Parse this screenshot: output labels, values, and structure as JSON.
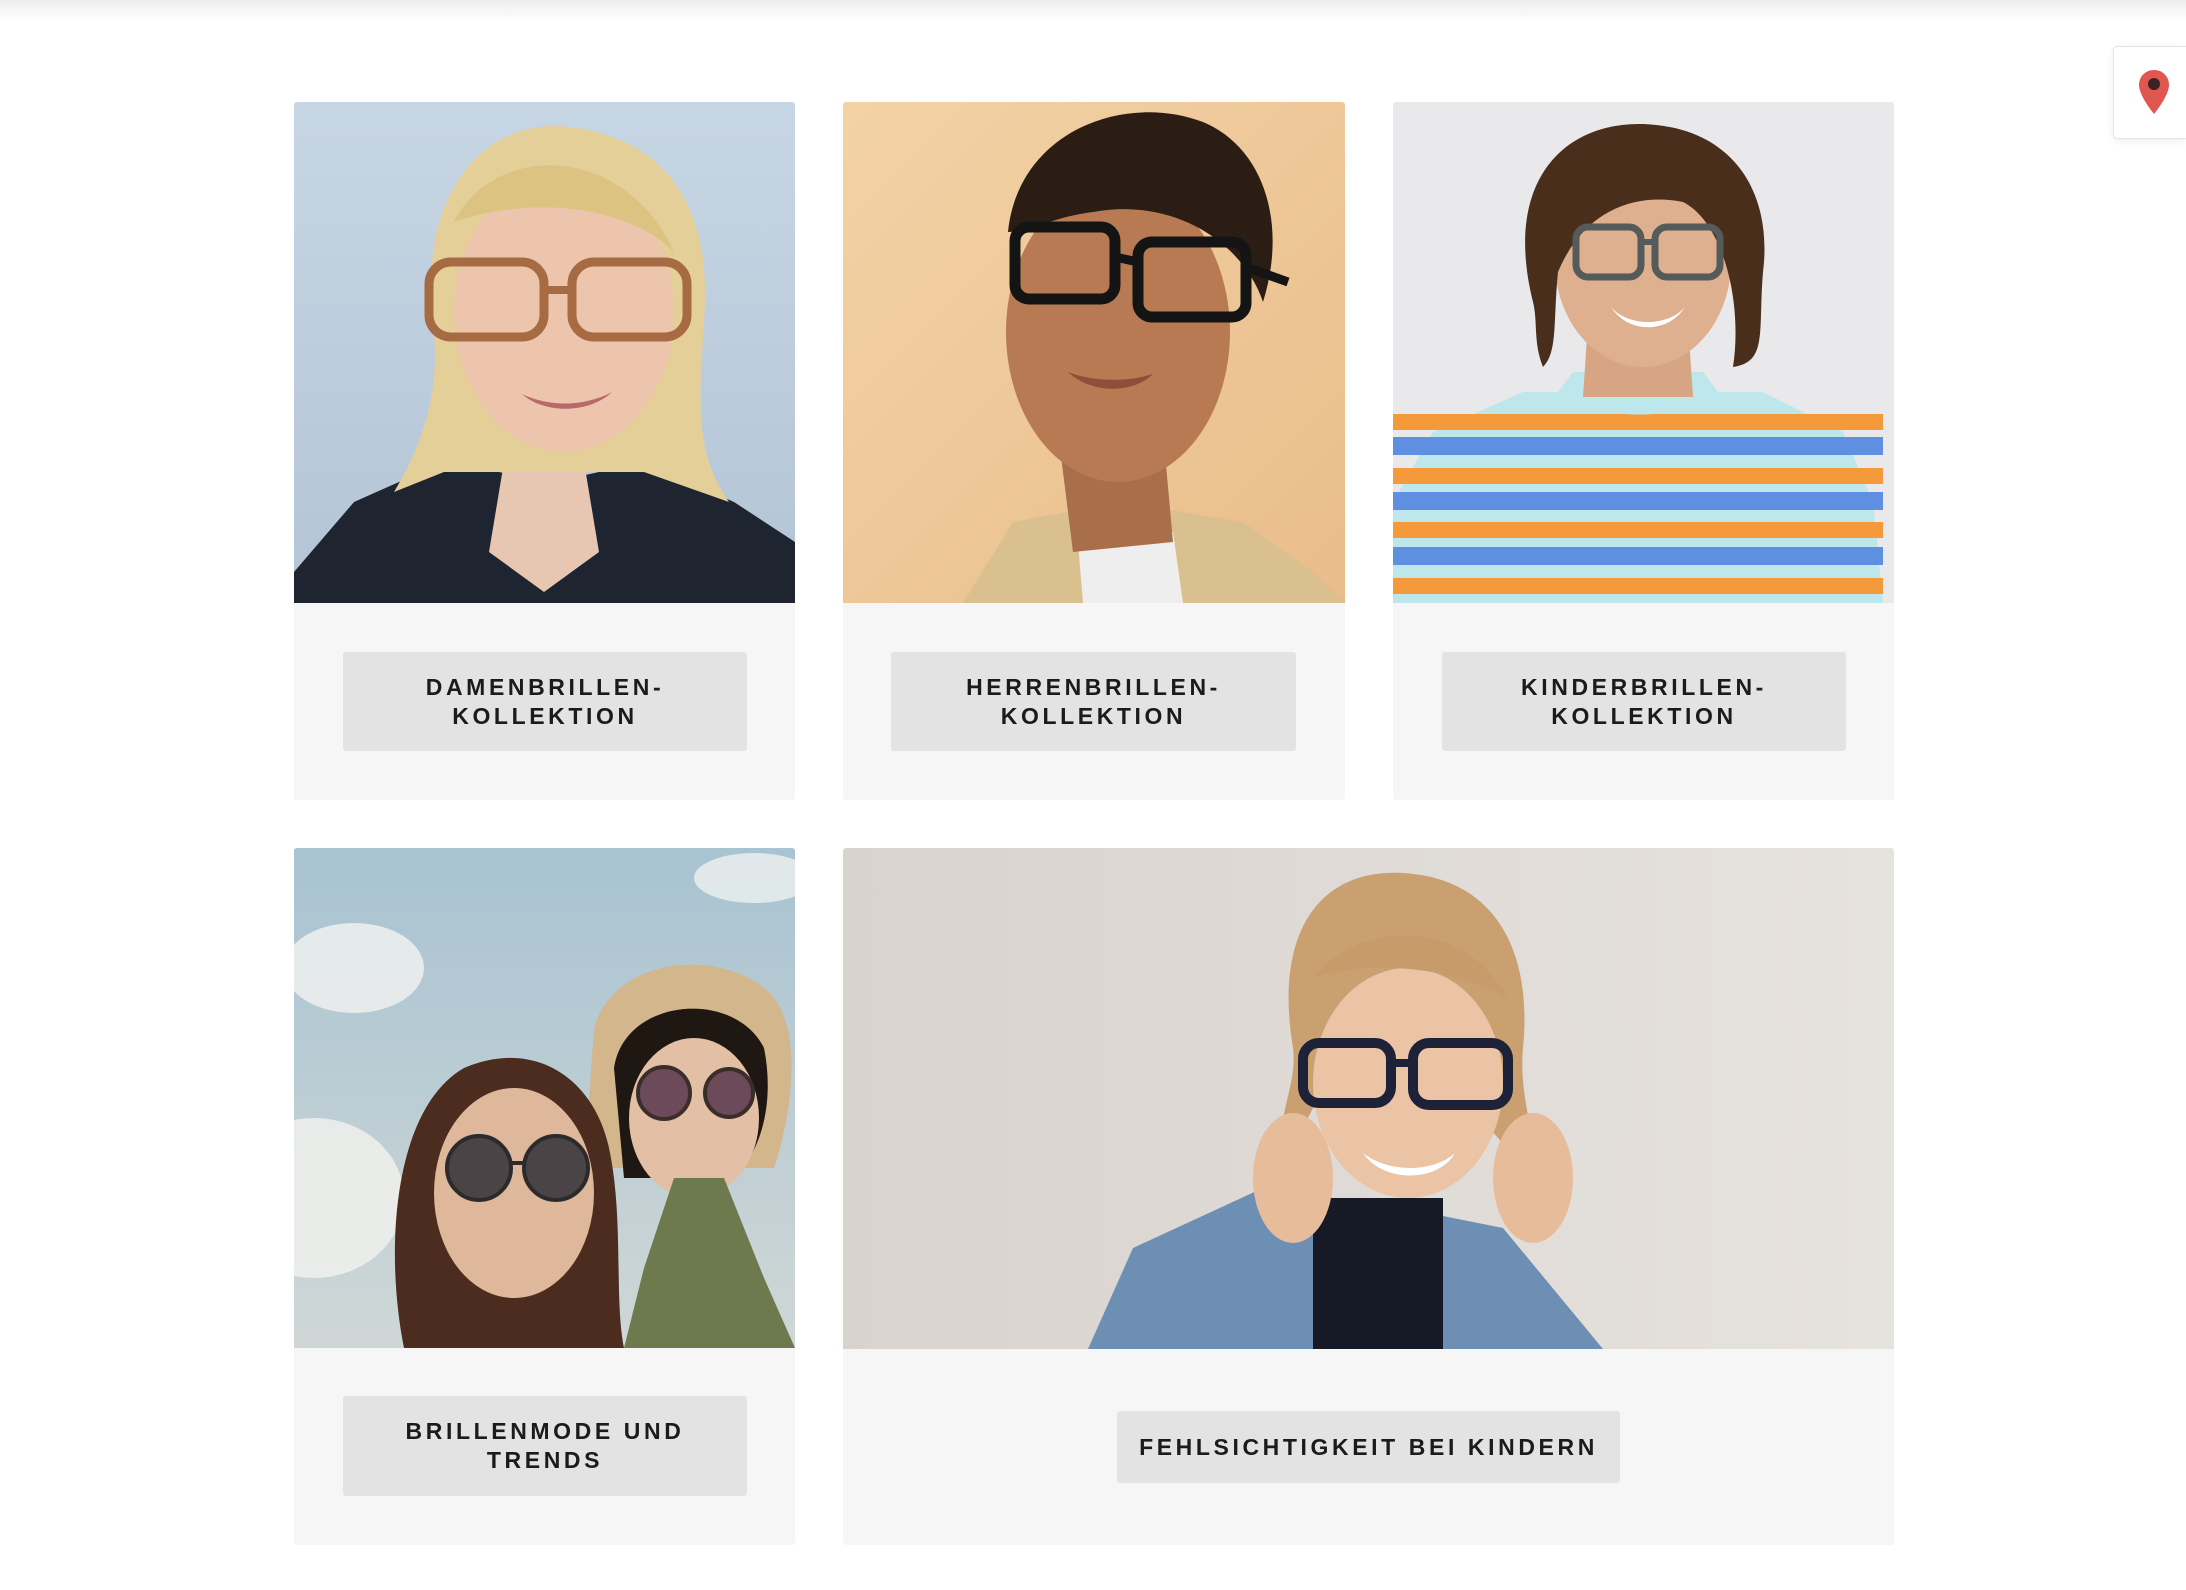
{
  "colors": {
    "card_background": "#f6f6f6",
    "button_background": "#e3e3e3",
    "button_text": "#1b1b1b",
    "location_pin": "#e0574f"
  },
  "location_tab": {
    "icon": "map-pin-icon"
  },
  "cards": [
    {
      "image": "woman-with-glasses-photo",
      "button_label": "DAMENBRILLEN-\nKOLLEKTION"
    },
    {
      "image": "man-with-glasses-photo",
      "button_label": "HERRENBRILLEN-\nKOLLEKTION"
    },
    {
      "image": "child-with-glasses-photo",
      "button_label": "KINDERBRILLEN-\nKOLLEKTION"
    },
    {
      "image": "women-with-sunglasses-photo",
      "button_label": "BRILLENMODE UND\nTRENDS"
    },
    {
      "image": "child-adjusting-glasses-photo",
      "button_label": "FEHLSICHTIGKEIT BEI KINDERN"
    }
  ]
}
